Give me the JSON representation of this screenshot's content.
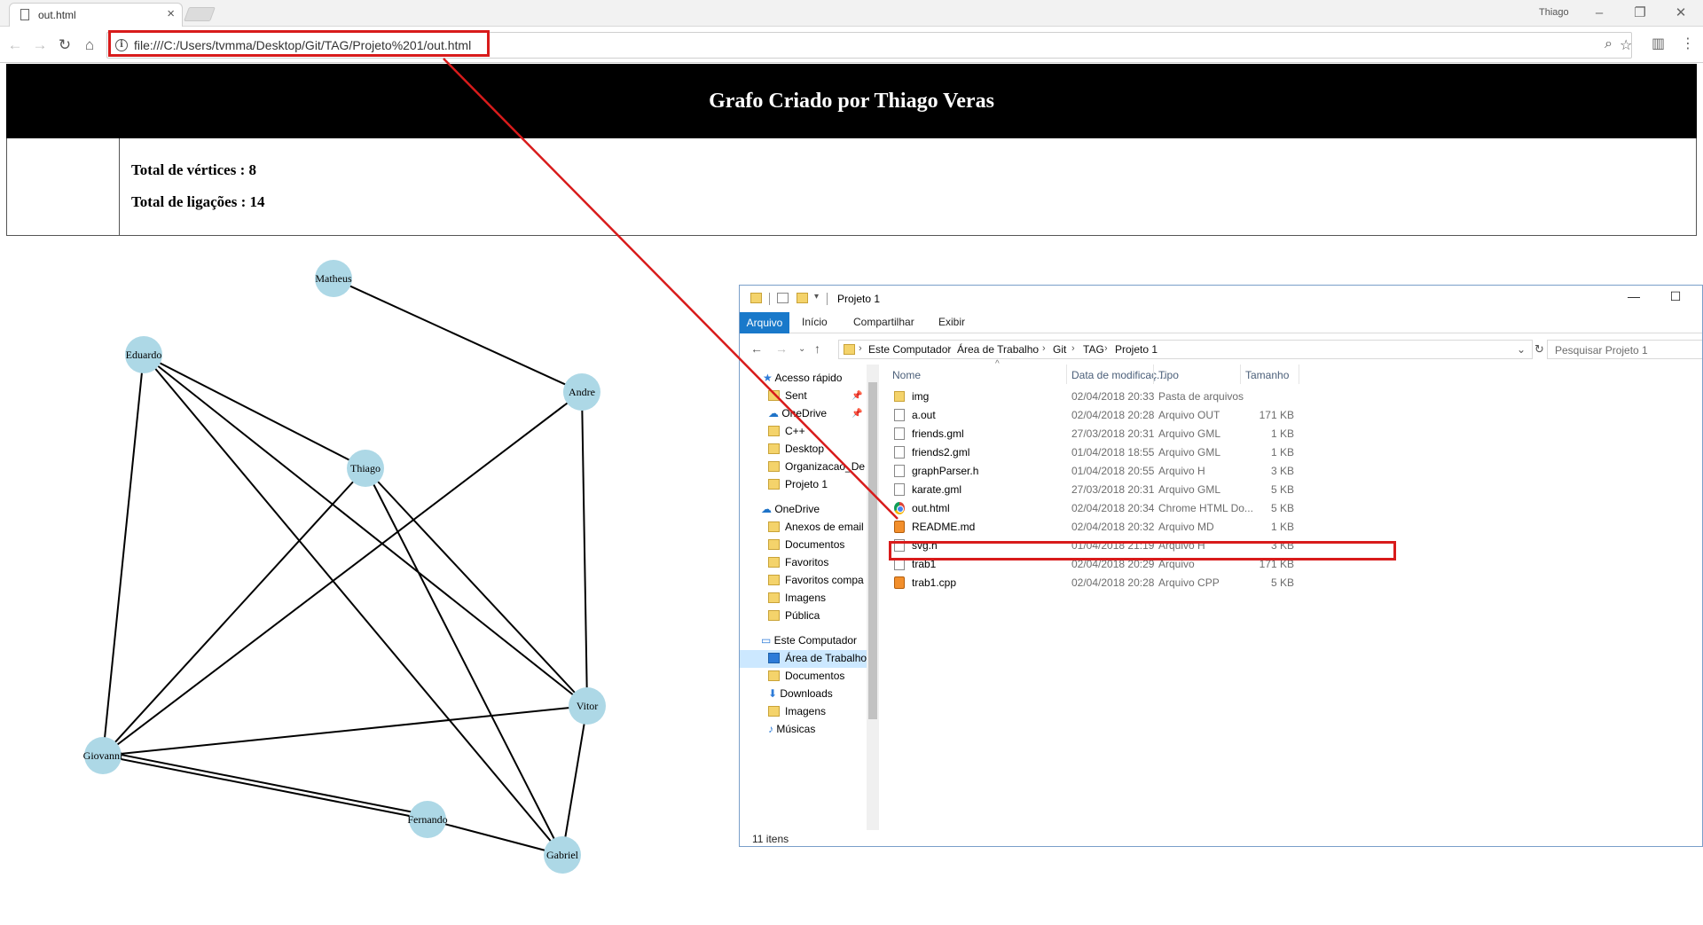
{
  "browser": {
    "tab_title": "out.html",
    "profile_name": "Thiago",
    "url": "file:///C:/Users/tvmma/Desktop/Git/TAG/Projeto%201/out.html"
  },
  "page": {
    "title": "Grafo Criado por Thiago Veras",
    "total_vertices": "Total de vértices : 8",
    "total_ligacoes": "Total de ligações : 14"
  },
  "graph": {
    "node_color": "#add8e6",
    "edge_color": "#000000",
    "nodes": [
      "Matheus",
      "Eduardo",
      "Andre",
      "Thiago",
      "Vitor",
      "Giovanni",
      "Fernando",
      "Gabriel"
    ],
    "edges": [
      [
        "Matheus",
        "Andre"
      ],
      [
        "Eduardo",
        "Giovanni"
      ],
      [
        "Eduardo",
        "Thiago"
      ],
      [
        "Eduardo",
        "Vitor"
      ],
      [
        "Eduardo",
        "Gabriel"
      ],
      [
        "Andre",
        "Giovanni"
      ],
      [
        "Andre",
        "Vitor"
      ],
      [
        "Thiago",
        "Giovanni"
      ],
      [
        "Thiago",
        "Vitor"
      ],
      [
        "Thiago",
        "Gabriel"
      ],
      [
        "Vitor",
        "Giovanni"
      ],
      [
        "Vitor",
        "Gabriel"
      ],
      [
        "Giovanni",
        "Fernando"
      ],
      [
        "Fernando",
        "Gabriel"
      ]
    ]
  },
  "explorer": {
    "title": "Projeto 1",
    "ribbon_tabs": [
      "Arquivo",
      "Início",
      "Compartilhar",
      "Exibir"
    ],
    "breadcrumb": [
      "Este Computador",
      "Área de Trabalho",
      "Git",
      "TAG",
      "Projeto 1"
    ],
    "search_placeholder": "Pesquisar Projeto 1",
    "nav_items": [
      {
        "label": "Acesso rápido"
      },
      {
        "label": "Sent"
      },
      {
        "label": "OneDrive"
      },
      {
        "label": "C++"
      },
      {
        "label": "Desktop"
      },
      {
        "label": "Organizacao_De"
      },
      {
        "label": "Projeto 1"
      },
      {
        "label": "OneDrive"
      },
      {
        "label": "Anexos de email"
      },
      {
        "label": "Documentos"
      },
      {
        "label": "Favoritos"
      },
      {
        "label": "Favoritos compa"
      },
      {
        "label": "Imagens"
      },
      {
        "label": "Pública"
      },
      {
        "label": "Este Computador"
      },
      {
        "label": "Área de Trabalho"
      },
      {
        "label": "Documentos"
      },
      {
        "label": "Downloads"
      },
      {
        "label": "Imagens"
      },
      {
        "label": "Músicas"
      }
    ],
    "columns": [
      "Nome",
      "Data de modificaç...",
      "Tipo",
      "Tamanho"
    ],
    "files": [
      {
        "name": "img",
        "date": "02/04/2018 20:33",
        "type": "Pasta de arquivos",
        "size": "",
        "icon": "folder-icon"
      },
      {
        "name": "a.out",
        "date": "02/04/2018 20:28",
        "type": "Arquivo OUT",
        "size": "171 KB",
        "icon": "file-icon"
      },
      {
        "name": "friends.gml",
        "date": "27/03/2018 20:31",
        "type": "Arquivo GML",
        "size": "1 KB",
        "icon": "file-icon"
      },
      {
        "name": "friends2.gml",
        "date": "01/04/2018 18:55",
        "type": "Arquivo GML",
        "size": "1 KB",
        "icon": "file-icon"
      },
      {
        "name": "graphParser.h",
        "date": "01/04/2018 20:55",
        "type": "Arquivo H",
        "size": "3 KB",
        "icon": "file-icon"
      },
      {
        "name": "karate.gml",
        "date": "27/03/2018 20:31",
        "type": "Arquivo GML",
        "size": "5 KB",
        "icon": "file-icon"
      },
      {
        "name": "out.html",
        "date": "02/04/2018 20:34",
        "type": "Chrome HTML Do...",
        "size": "5 KB",
        "icon": "chrome-icon"
      },
      {
        "name": "README.md",
        "date": "02/04/2018 20:32",
        "type": "Arquivo MD",
        "size": "1 KB",
        "icon": "sublime-icon"
      },
      {
        "name": "svg.h",
        "date": "01/04/2018 21:19",
        "type": "Arquivo H",
        "size": "3 KB",
        "icon": "file-icon"
      },
      {
        "name": "trab1",
        "date": "02/04/2018 20:29",
        "type": "Arquivo",
        "size": "171 KB",
        "icon": "file-icon"
      },
      {
        "name": "trab1.cpp",
        "date": "02/04/2018 20:28",
        "type": "Arquivo CPP",
        "size": "5 KB",
        "icon": "sublime-icon"
      }
    ],
    "status": "11 itens"
  },
  "annotation_color": "#d81b1b"
}
